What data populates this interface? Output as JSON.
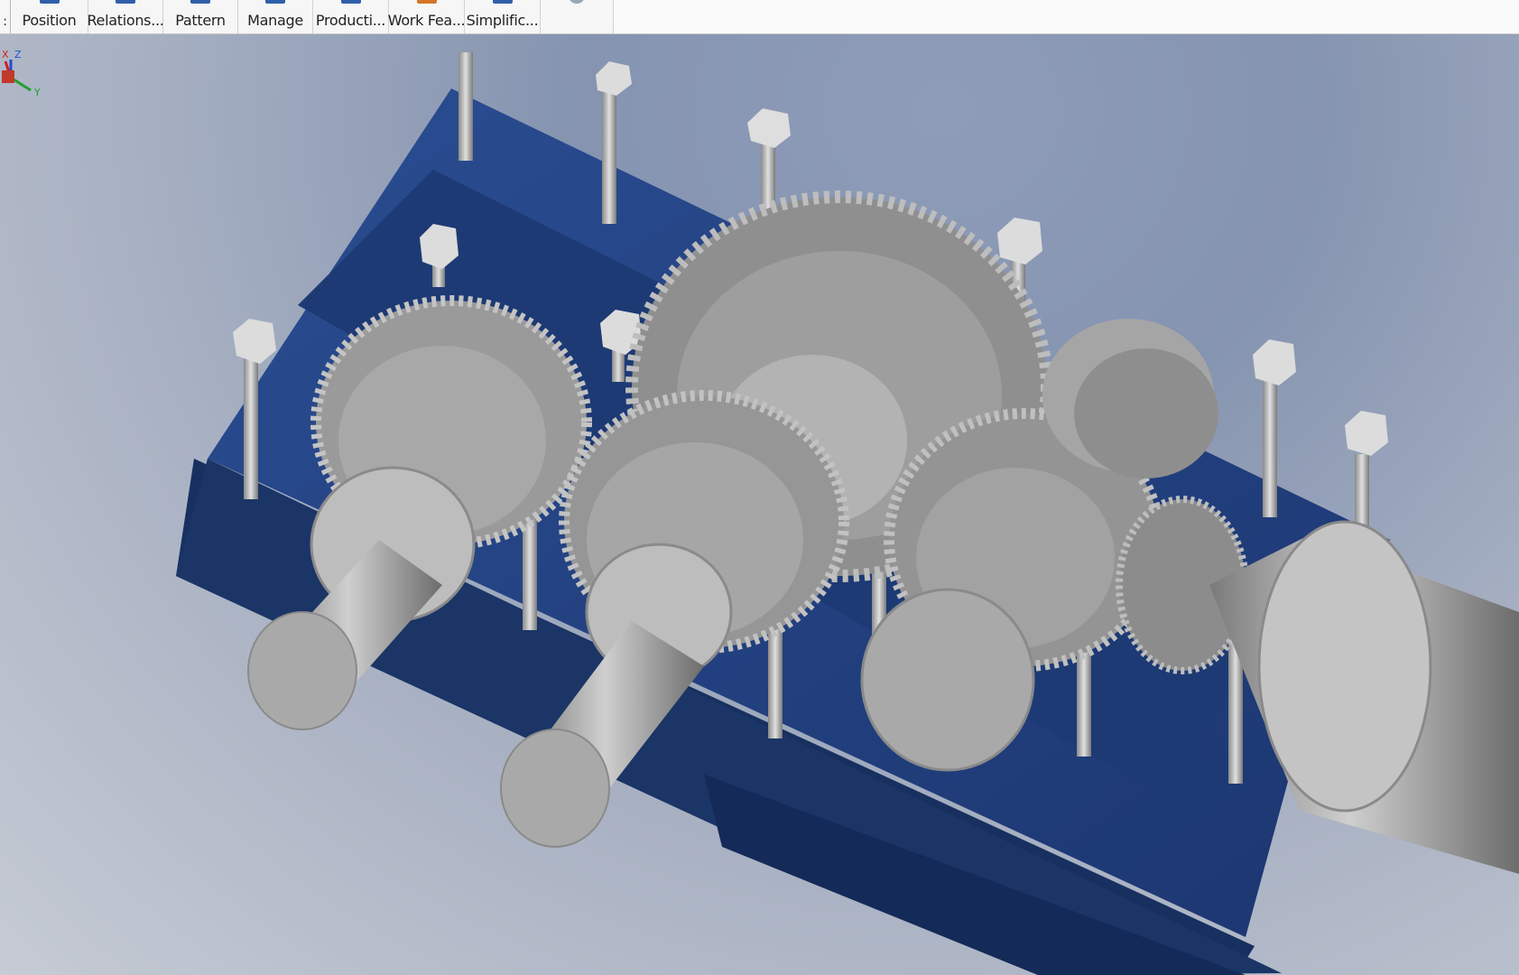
{
  "ribbon": {
    "partial_left_label": ":",
    "panels": [
      {
        "label": "Position",
        "icon": "position-icon",
        "color": "#2f5fa8"
      },
      {
        "label": "Relations...",
        "icon": "relationships-icon",
        "color": "#2f5fa8"
      },
      {
        "label": "Pattern",
        "icon": "pattern-icon",
        "color": "#2f5fa8"
      },
      {
        "label": "Manage",
        "icon": "manage-icon",
        "color": "#2f5fa8"
      },
      {
        "label": "Producti...",
        "icon": "productivity-icon",
        "color": "#2f5fa8"
      },
      {
        "label": "Work Fea...",
        "icon": "work-features-icon",
        "color": "#d4762a"
      },
      {
        "label": "Simplific...",
        "icon": "simplification-icon",
        "color": "#2f5fa8"
      }
    ]
  },
  "viewport": {
    "model": "gearbox-assembly",
    "colors": {
      "housing": "#1f3a74",
      "housing_dark": "#142a58",
      "metal": "#9c9c9c",
      "metal_light": "#c9c9c9",
      "background_top": "#8594b0",
      "background_bottom": "#c6cbd4"
    },
    "triad": {
      "x_label": "X",
      "y_label": "Y",
      "z_label": "Z"
    }
  }
}
